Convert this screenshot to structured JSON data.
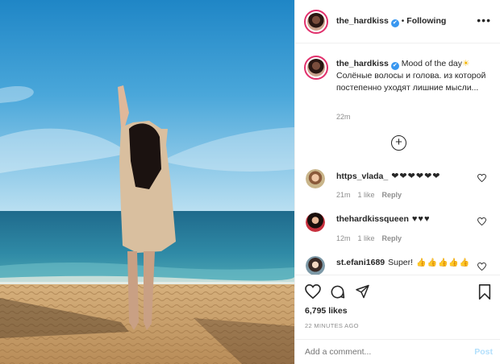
{
  "post": {
    "username": "the_hardkiss",
    "verified_mark": "✔",
    "separator": "•",
    "follow_status": "Following",
    "more_glyph": "•••"
  },
  "caption": {
    "username": "the_hardkiss",
    "text_lead": "Mood of the day",
    "sun_emoji": "☀",
    "text_body": "Солёные волосы и голова. из которой постепенно уходят лишние мысли...",
    "time": "22m"
  },
  "load_more_glyph": "+",
  "comments": [
    {
      "username": "https_vlada_",
      "text": "❤❤❤❤❤❤",
      "time": "21m",
      "likes": "1 like",
      "reply": "Reply"
    },
    {
      "username": "thehardkissqueen",
      "text": "♥♥♥",
      "time": "12m",
      "likes": "1 like",
      "reply": "Reply"
    },
    {
      "username": "st.efani1689",
      "text_word": "Super!",
      "text_emoji": "👍👍👍👍👍"
    }
  ],
  "likes_count": "6,795 likes",
  "timestamp": "22 MINUTES AGO",
  "add_comment": {
    "placeholder": "Add a comment...",
    "post_label": "Post"
  },
  "colors": {
    "link_blue": "#3897f0",
    "post_disabled": "#b2dffc",
    "heart_red": "#e0245e",
    "muted": "#8e8e8e"
  },
  "icons": [
    "heart-icon",
    "comment-icon",
    "share-icon",
    "bookmark-icon",
    "plus-circle-icon",
    "more-options-icon",
    "verified-badge-icon"
  ]
}
